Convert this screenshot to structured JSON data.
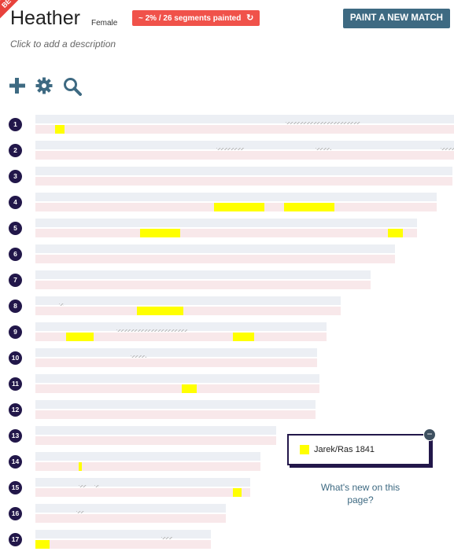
{
  "header": {
    "beta_label": "BE",
    "profile_name": "Heather",
    "profile_sex": "Female",
    "painted_summary": "~ 2% / 26 segments painted",
    "new_match_label": "PAINT A NEW MATCH",
    "description_placeholder": "Click to add a description"
  },
  "toolbar": {
    "icons": [
      "plus-icon",
      "gear-icon",
      "search-icon"
    ]
  },
  "colors": {
    "accent": "#3e6a82",
    "badge": "#f0524a",
    "chromosome_number_bg": "#22174a",
    "paternal_bar": "#eceff4",
    "maternal_bar": "#f8e8ea",
    "match_segment": "#ffff00"
  },
  "chromosomes": [
    {
      "number": "1"
    },
    {
      "number": "2"
    },
    {
      "number": "3"
    },
    {
      "number": "4"
    },
    {
      "number": "5"
    },
    {
      "number": "6"
    },
    {
      "number": "7"
    },
    {
      "number": "8"
    },
    {
      "number": "9"
    },
    {
      "number": "10"
    },
    {
      "number": "11"
    },
    {
      "number": "12"
    },
    {
      "number": "13"
    },
    {
      "number": "14"
    },
    {
      "number": "15"
    },
    {
      "number": "16"
    },
    {
      "number": "17"
    }
  ],
  "legend": {
    "match_name": "Jarek/Ras 1841",
    "collapse_symbol": "−"
  },
  "help_link": "What's new on this page?"
}
